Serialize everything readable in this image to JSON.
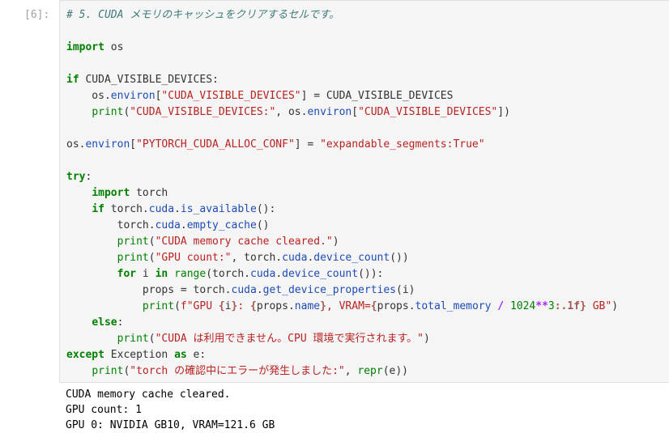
{
  "cell": {
    "prompt": "[6]:",
    "lines": [
      [
        {
          "c": "cm",
          "t": "# 5. CUDA メモリのキャッシュをクリアするセルです。"
        }
      ],
      [],
      [
        {
          "c": "kw",
          "t": "import"
        },
        {
          "c": "pl",
          "t": " os"
        }
      ],
      [],
      [
        {
          "c": "kw",
          "t": "if"
        },
        {
          "c": "pl",
          "t": " CUDA_VISIBLE_DEVICES:"
        }
      ],
      [
        {
          "c": "pl",
          "t": "    os."
        },
        {
          "c": "at",
          "t": "environ"
        },
        {
          "c": "pl",
          "t": "["
        },
        {
          "c": "st",
          "t": "\"CUDA_VISIBLE_DEVICES\""
        },
        {
          "c": "pl",
          "t": "] = CUDA_VISIBLE_DEVICES"
        }
      ],
      [
        {
          "c": "pl",
          "t": "    "
        },
        {
          "c": "nm",
          "t": "print"
        },
        {
          "c": "pl",
          "t": "("
        },
        {
          "c": "st",
          "t": "\"CUDA_VISIBLE_DEVICES:\""
        },
        {
          "c": "pl",
          "t": ", os."
        },
        {
          "c": "at",
          "t": "environ"
        },
        {
          "c": "pl",
          "t": "["
        },
        {
          "c": "st",
          "t": "\"CUDA_VISIBLE_DEVICES\""
        },
        {
          "c": "pl",
          "t": "])"
        }
      ],
      [],
      [
        {
          "c": "pl",
          "t": "os."
        },
        {
          "c": "at",
          "t": "environ"
        },
        {
          "c": "pl",
          "t": "["
        },
        {
          "c": "st",
          "t": "\"PYTORCH_CUDA_ALLOC_CONF\""
        },
        {
          "c": "pl",
          "t": "] = "
        },
        {
          "c": "st",
          "t": "\"expandable_segments:True\""
        }
      ],
      [],
      [
        {
          "c": "kw",
          "t": "try"
        },
        {
          "c": "pl",
          "t": ":"
        }
      ],
      [
        {
          "c": "pl",
          "t": "    "
        },
        {
          "c": "kw",
          "t": "import"
        },
        {
          "c": "pl",
          "t": " torch"
        }
      ],
      [
        {
          "c": "pl",
          "t": "    "
        },
        {
          "c": "kw",
          "t": "if"
        },
        {
          "c": "pl",
          "t": " torch."
        },
        {
          "c": "at",
          "t": "cuda"
        },
        {
          "c": "pl",
          "t": "."
        },
        {
          "c": "at",
          "t": "is_available"
        },
        {
          "c": "pl",
          "t": "():"
        }
      ],
      [
        {
          "c": "pl",
          "t": "        torch."
        },
        {
          "c": "at",
          "t": "cuda"
        },
        {
          "c": "pl",
          "t": "."
        },
        {
          "c": "at",
          "t": "empty_cache"
        },
        {
          "c": "pl",
          "t": "()"
        }
      ],
      [
        {
          "c": "pl",
          "t": "        "
        },
        {
          "c": "nm",
          "t": "print"
        },
        {
          "c": "pl",
          "t": "("
        },
        {
          "c": "st",
          "t": "\"CUDA memory cache cleared.\""
        },
        {
          "c": "pl",
          "t": ")"
        }
      ],
      [
        {
          "c": "pl",
          "t": "        "
        },
        {
          "c": "nm",
          "t": "print"
        },
        {
          "c": "pl",
          "t": "("
        },
        {
          "c": "st",
          "t": "\"GPU count:\""
        },
        {
          "c": "pl",
          "t": ", torch."
        },
        {
          "c": "at",
          "t": "cuda"
        },
        {
          "c": "pl",
          "t": "."
        },
        {
          "c": "at",
          "t": "device_count"
        },
        {
          "c": "pl",
          "t": "())"
        }
      ],
      [
        {
          "c": "pl",
          "t": "        "
        },
        {
          "c": "kw",
          "t": "for"
        },
        {
          "c": "pl",
          "t": " i "
        },
        {
          "c": "kw",
          "t": "in"
        },
        {
          "c": "pl",
          "t": " "
        },
        {
          "c": "nm",
          "t": "range"
        },
        {
          "c": "pl",
          "t": "(torch."
        },
        {
          "c": "at",
          "t": "cuda"
        },
        {
          "c": "pl",
          "t": "."
        },
        {
          "c": "at",
          "t": "device_count"
        },
        {
          "c": "pl",
          "t": "()):"
        }
      ],
      [
        {
          "c": "pl",
          "t": "            props = torch."
        },
        {
          "c": "at",
          "t": "cuda"
        },
        {
          "c": "pl",
          "t": "."
        },
        {
          "c": "at",
          "t": "get_device_properties"
        },
        {
          "c": "pl",
          "t": "(i)"
        }
      ],
      [
        {
          "c": "pl",
          "t": "            "
        },
        {
          "c": "nm",
          "t": "print"
        },
        {
          "c": "pl",
          "t": "("
        },
        {
          "c": "st",
          "t": "f\"GPU "
        },
        {
          "c": "sp",
          "t": "{"
        },
        {
          "c": "pl",
          "t": "i"
        },
        {
          "c": "sp",
          "t": "}"
        },
        {
          "c": "st",
          "t": ": "
        },
        {
          "c": "sp",
          "t": "{"
        },
        {
          "c": "pl",
          "t": "props."
        },
        {
          "c": "at",
          "t": "name"
        },
        {
          "c": "sp",
          "t": "}"
        },
        {
          "c": "st",
          "t": ", VRAM="
        },
        {
          "c": "sp",
          "t": "{"
        },
        {
          "c": "pl",
          "t": "props."
        },
        {
          "c": "at",
          "t": "total_memory"
        },
        {
          "c": "pl",
          "t": " "
        },
        {
          "c": "op",
          "t": "/"
        },
        {
          "c": "pl",
          "t": " "
        },
        {
          "c": "nm",
          "t": "1024"
        },
        {
          "c": "op",
          "t": "**"
        },
        {
          "c": "nm",
          "t": "3"
        },
        {
          "c": "sp",
          "t": ":.1f}"
        },
        {
          "c": "st",
          "t": " GB\""
        },
        {
          "c": "pl",
          "t": ")"
        }
      ],
      [
        {
          "c": "pl",
          "t": "    "
        },
        {
          "c": "kw",
          "t": "else"
        },
        {
          "c": "pl",
          "t": ":"
        }
      ],
      [
        {
          "c": "pl",
          "t": "        "
        },
        {
          "c": "nm",
          "t": "print"
        },
        {
          "c": "pl",
          "t": "("
        },
        {
          "c": "st",
          "t": "\"CUDA は利用できません。CPU 環境で実行されます。\""
        },
        {
          "c": "pl",
          "t": ")"
        }
      ],
      [
        {
          "c": "kw",
          "t": "except"
        },
        {
          "c": "pl",
          "t": " Exception "
        },
        {
          "c": "kw",
          "t": "as"
        },
        {
          "c": "pl",
          "t": " e:"
        }
      ],
      [
        {
          "c": "pl",
          "t": "    "
        },
        {
          "c": "nm",
          "t": "print"
        },
        {
          "c": "pl",
          "t": "("
        },
        {
          "c": "st",
          "t": "\"torch の確認中にエラーが発生しました:\""
        },
        {
          "c": "pl",
          "t": ", "
        },
        {
          "c": "nm",
          "t": "repr"
        },
        {
          "c": "pl",
          "t": "(e))"
        }
      ]
    ]
  },
  "output": {
    "lines": [
      "CUDA memory cache cleared.",
      "GPU count: 1",
      "GPU 0: NVIDIA GB10, VRAM=121.6 GB"
    ]
  }
}
